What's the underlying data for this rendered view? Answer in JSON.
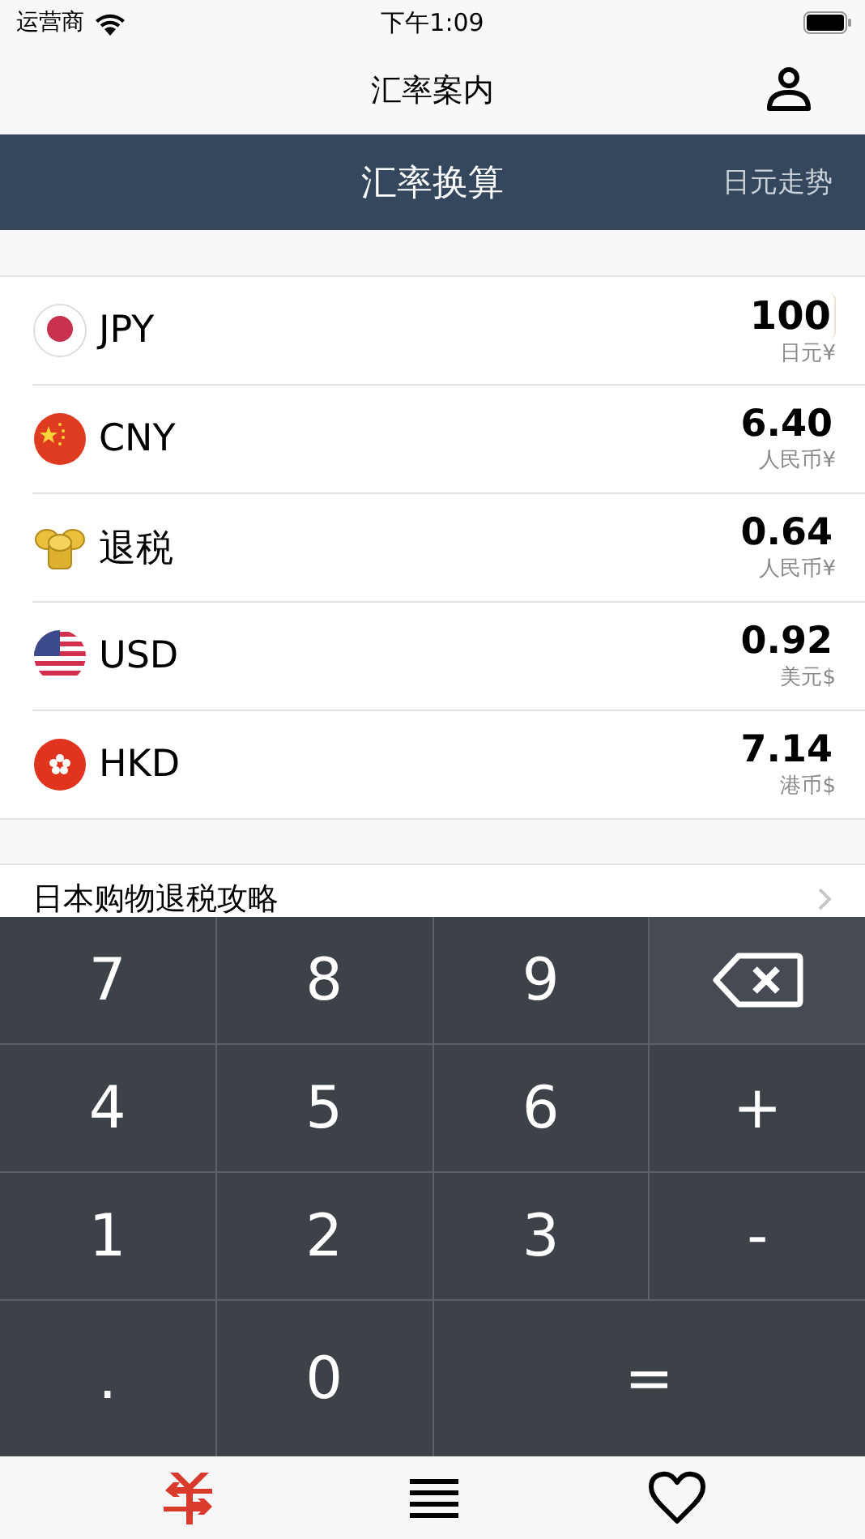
{
  "status_bar": {
    "carrier": "运营商",
    "time": "下午1:09"
  },
  "nav": {
    "title": "汇率案内"
  },
  "header": {
    "title": "汇率换算",
    "link": "日元走势"
  },
  "rates": [
    {
      "kind": "jp",
      "code": "JPY",
      "value": "100",
      "unit": "日元¥",
      "selected": true
    },
    {
      "kind": "cn",
      "code": "CNY",
      "value": "6.40",
      "unit": "人民币¥",
      "selected": false
    },
    {
      "kind": "coins",
      "code": "退税",
      "value": "0.64",
      "unit": "人民币¥",
      "selected": false
    },
    {
      "kind": "us",
      "code": "USD",
      "value": "0.92",
      "unit": "美元$",
      "selected": false
    },
    {
      "kind": "hk",
      "code": "HKD",
      "value": "7.14",
      "unit": "港币$",
      "selected": false
    }
  ],
  "guide": {
    "label": "日本购物退税攻略"
  },
  "keypad": [
    {
      "kind": "digit",
      "label": "7"
    },
    {
      "kind": "digit",
      "label": "8"
    },
    {
      "kind": "digit",
      "label": "9"
    },
    {
      "kind": "backspace"
    },
    {
      "kind": "digit",
      "label": "4"
    },
    {
      "kind": "digit",
      "label": "5"
    },
    {
      "kind": "digit",
      "label": "6"
    },
    {
      "kind": "op",
      "label": "+"
    },
    {
      "kind": "digit",
      "label": "1"
    },
    {
      "kind": "digit",
      "label": "2"
    },
    {
      "kind": "digit",
      "label": "3"
    },
    {
      "kind": "op",
      "label": "-"
    },
    {
      "kind": "digit",
      "label": "."
    },
    {
      "kind": "digit",
      "label": "0"
    },
    {
      "kind": "equals",
      "label": "="
    }
  ],
  "tabs": [
    {
      "kind": "yen",
      "selected": true
    },
    {
      "kind": "list",
      "selected": false
    },
    {
      "kind": "heart",
      "selected": false
    }
  ]
}
